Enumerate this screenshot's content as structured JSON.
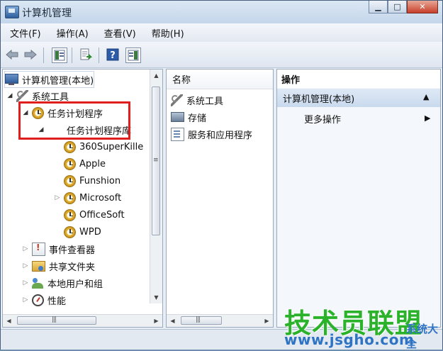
{
  "window": {
    "title": "计算机管理",
    "controls": {
      "minimize": "▁",
      "maximize": "□",
      "close": "✕"
    }
  },
  "menu": [
    "文件(F)",
    "操作(A)",
    "查看(V)",
    "帮助(H)"
  ],
  "toolbar": {
    "icons": [
      "back-arrow-icon",
      "forward-arrow-icon",
      "show-tree-icon",
      "export-list-icon",
      "help-icon",
      "properties-pane-icon"
    ]
  },
  "tree": {
    "root": "计算机管理(本地)",
    "system_tools": "系统工具",
    "task_scheduler": "任务计划程序",
    "task_library": "任务计划程序库",
    "tasks": [
      "360SuperKille",
      "Apple",
      "Funshion",
      "Microsoft",
      "OfficeSoft",
      "WPD"
    ],
    "event_viewer": "事件查看器",
    "shared_folders": "共享文件夹",
    "local_users": "本地用户和组",
    "performance": "性能"
  },
  "list": {
    "header": "名称",
    "items": [
      "系统工具",
      "存储",
      "服务和应用程序"
    ]
  },
  "actions": {
    "header": "操作",
    "section": "计算机管理(本地)",
    "more": "更多操作"
  },
  "watermark": {
    "main": "技术员联盟",
    "url": "www.jsgho.com",
    "side": "系统大全"
  },
  "colors": {
    "highlight": "#e01e1e",
    "watermark_green": "#2bb22b",
    "watermark_blue": "#2f74c4"
  }
}
